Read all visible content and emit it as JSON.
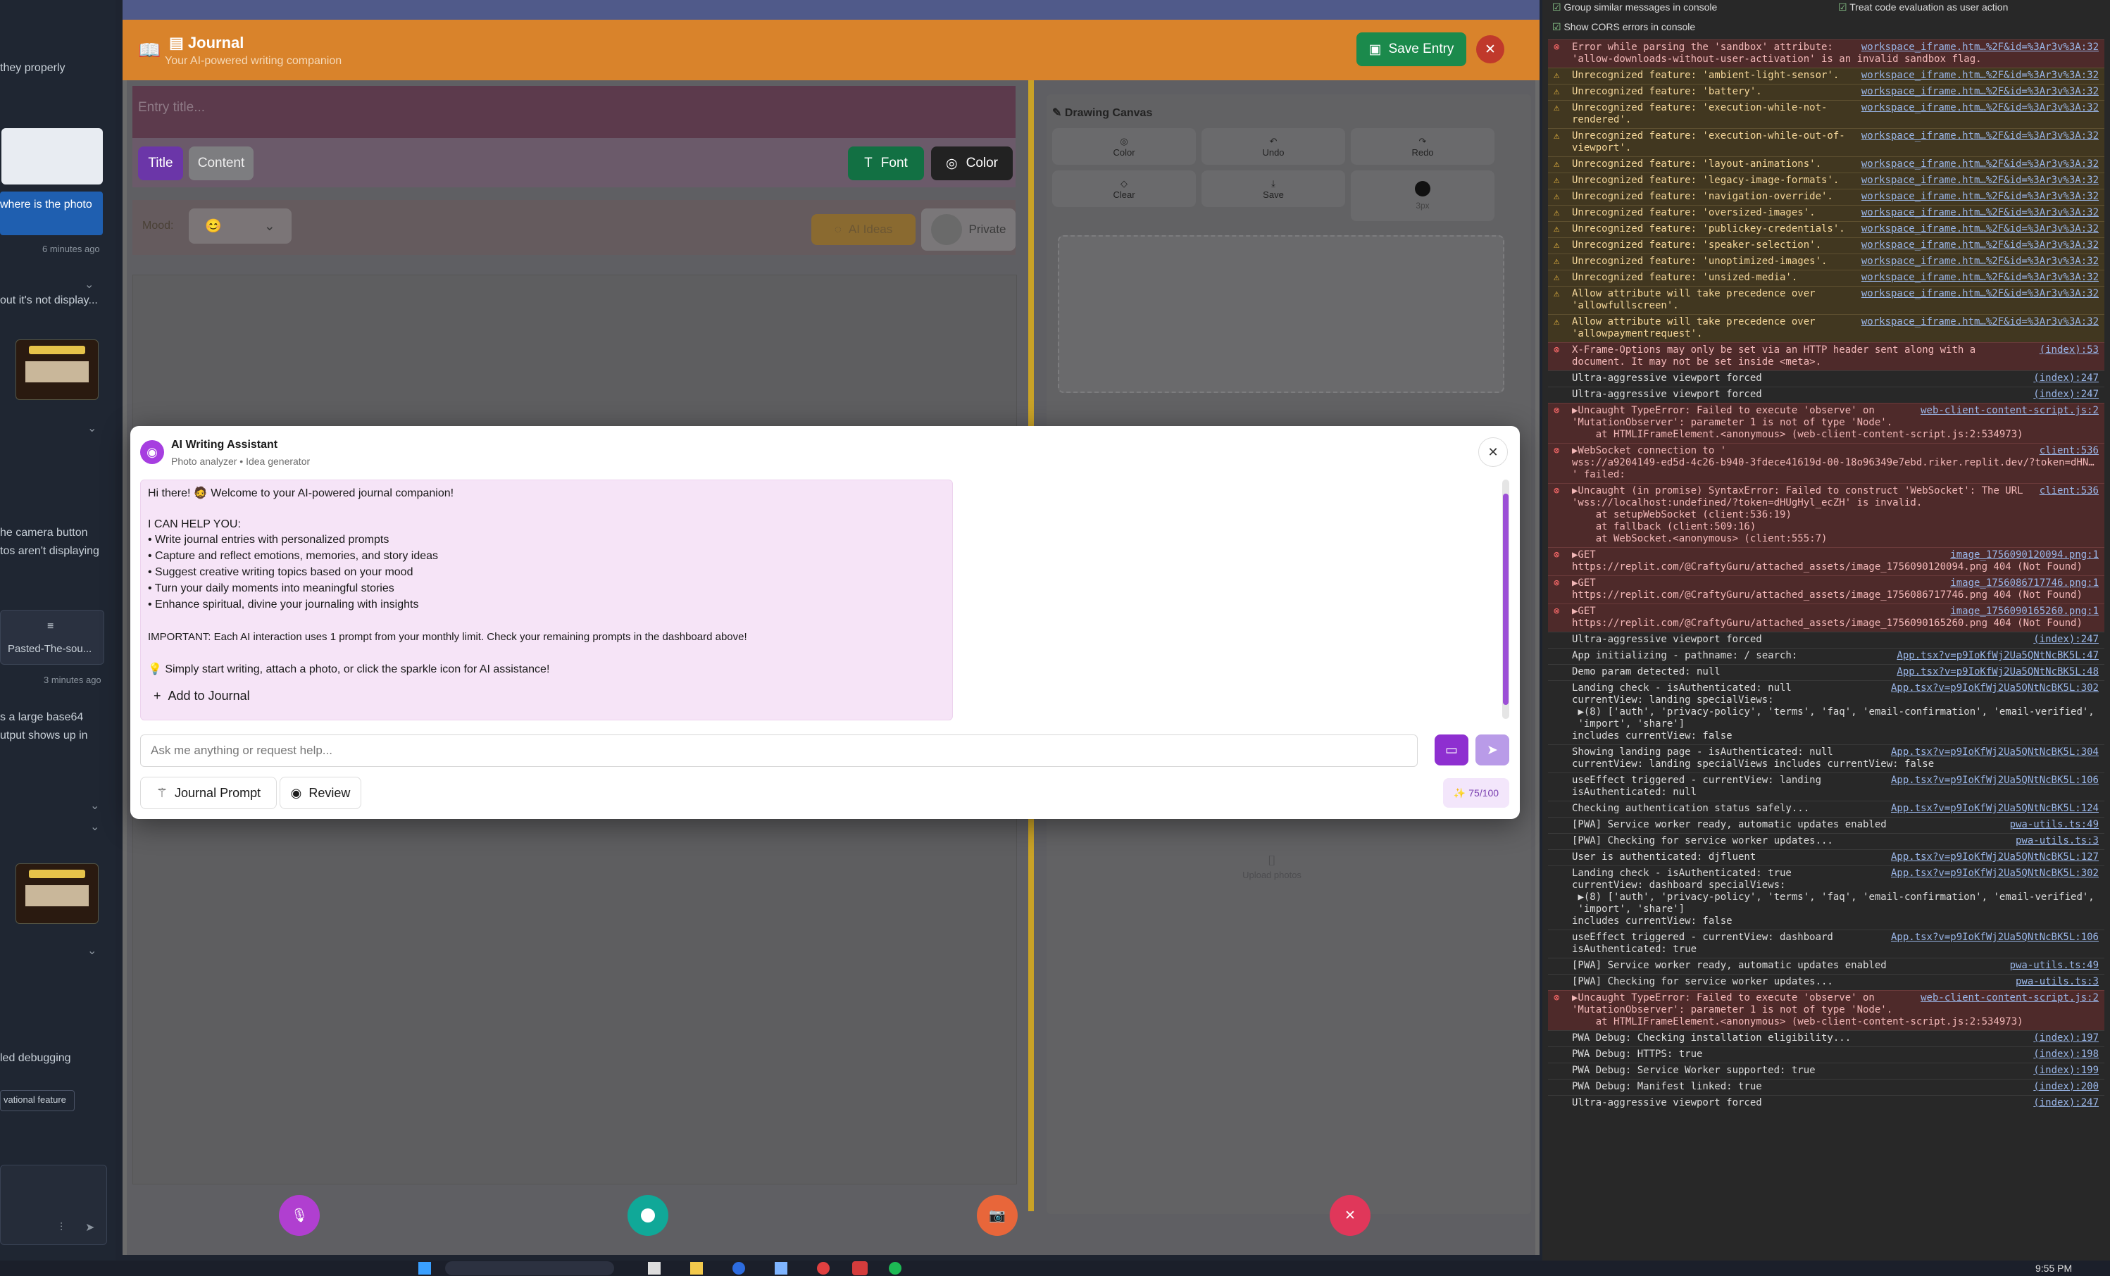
{
  "left_panel": {
    "snippets": [
      "they properly",
      "where is the photo",
      "6 minutes ago",
      "out it's not display...",
      "he camera button",
      "tos aren't displaying",
      "Pasted-The-sou...",
      "3 minutes ago",
      "s a large base64",
      "utput shows up in",
      "led debugging",
      "vational feature"
    ]
  },
  "journal": {
    "title": "Journal",
    "subtitle": "Your AI-powered writing companion",
    "save_label": "Save Entry",
    "title_placeholder": "Entry title...",
    "tab_title": "Title",
    "tab_content": "Content",
    "font_label": "Font",
    "color_label": "Color",
    "mood_label": "Mood:",
    "mood_value": "😊",
    "ai_ideas_label": "AI Ideas",
    "private_label": "Private",
    "upload_photos_label": "Upload photos"
  },
  "drawing": {
    "title": "Drawing Canvas",
    "tools": [
      "Color",
      "Undo",
      "Redo",
      "Clear",
      "Save",
      "3px"
    ]
  },
  "assistant": {
    "title": "AI Writing Assistant",
    "subtitle": "Photo analyzer • Idea generator",
    "greeting": "Hi there! 🧔 Welcome to your AI-powered journal companion!",
    "help_heading": "I CAN HELP YOU:",
    "help_items": [
      "• Write journal entries with personalized prompts",
      "• Capture and reflect emotions, memories, and story ideas",
      "• Suggest creative writing topics based on your mood",
      "• Turn your daily moments into meaningful stories",
      "• Enhance spiritual, divine your journaling with insights"
    ],
    "important": "IMPORTANT: Each AI interaction uses 1 prompt from your monthly limit. Check your remaining prompts in the dashboard above!",
    "tip": "💡 Simply start writing, attach a photo, or click the sparkle icon for AI assistance!",
    "add_label": "Add to Journal",
    "input_placeholder": "Ask me anything or request help...",
    "prompt_button": "Journal Prompt",
    "review_button": "Review",
    "quota": "✨ 75/100"
  },
  "console": {
    "options": [
      "Group similar messages in console",
      "Treat code evaluation as user action",
      "Show CORS errors in console"
    ],
    "messages": [
      {
        "level": "err",
        "text": "Error while parsing the 'sandbox' attribute:\n'allow-downloads-without-user-activation' is an invalid sandbox flag.",
        "src": "workspace_iframe.htm…%2F&id=%3Ar3v%3A:32"
      },
      {
        "level": "warn",
        "text": "Unrecognized feature: 'ambient-light-sensor'.",
        "src": "workspace_iframe.htm…%2F&id=%3Ar3v%3A:32"
      },
      {
        "level": "warn",
        "text": "Unrecognized feature: 'battery'.",
        "src": "workspace_iframe.htm…%2F&id=%3Ar3v%3A:32"
      },
      {
        "level": "warn",
        "text": "Unrecognized feature: 'execution-while-not-\nrendered'.",
        "src": "workspace_iframe.htm…%2F&id=%3Ar3v%3A:32"
      },
      {
        "level": "warn",
        "text": "Unrecognized feature: 'execution-while-out-of-\nviewport'.",
        "src": "workspace_iframe.htm…%2F&id=%3Ar3v%3A:32"
      },
      {
        "level": "warn",
        "text": "Unrecognized feature: 'layout-animations'.",
        "src": "workspace_iframe.htm…%2F&id=%3Ar3v%3A:32"
      },
      {
        "level": "warn",
        "text": "Unrecognized feature: 'legacy-image-formats'.",
        "src": "workspace_iframe.htm…%2F&id=%3Ar3v%3A:32"
      },
      {
        "level": "warn",
        "text": "Unrecognized feature: 'navigation-override'.",
        "src": "workspace_iframe.htm…%2F&id=%3Ar3v%3A:32"
      },
      {
        "level": "warn",
        "text": "Unrecognized feature: 'oversized-images'.",
        "src": "workspace_iframe.htm…%2F&id=%3Ar3v%3A:32"
      },
      {
        "level": "warn",
        "text": "Unrecognized feature: 'publickey-credentials'.",
        "src": "workspace_iframe.htm…%2F&id=%3Ar3v%3A:32"
      },
      {
        "level": "warn",
        "text": "Unrecognized feature: 'speaker-selection'.",
        "src": "workspace_iframe.htm…%2F&id=%3Ar3v%3A:32"
      },
      {
        "level": "warn",
        "text": "Unrecognized feature: 'unoptimized-images'.",
        "src": "workspace_iframe.htm…%2F&id=%3Ar3v%3A:32"
      },
      {
        "level": "warn",
        "text": "Unrecognized feature: 'unsized-media'.",
        "src": "workspace_iframe.htm…%2F&id=%3Ar3v%3A:32"
      },
      {
        "level": "warn",
        "text": "Allow attribute will take precedence over\n'allowfullscreen'.",
        "src": "workspace_iframe.htm…%2F&id=%3Ar3v%3A:32"
      },
      {
        "level": "warn",
        "text": "Allow attribute will take precedence over\n'allowpaymentrequest'.",
        "src": "workspace_iframe.htm…%2F&id=%3Ar3v%3A:32"
      },
      {
        "level": "err",
        "text": "X-Frame-Options may only be set via an HTTP header sent along with a\ndocument. It may not be set inside <meta>.",
        "src": "(index):53"
      },
      {
        "level": "info",
        "text": "Ultra-aggressive viewport forced",
        "src": "(index):247"
      },
      {
        "level": "info",
        "text": "Ultra-aggressive viewport forced",
        "src": "(index):247"
      },
      {
        "level": "err",
        "text": "▶Uncaught TypeError: Failed to execute 'observe' on\n'MutationObserver': parameter 1 is not of type 'Node'.\n    at HTMLIFrameElement.<anonymous> (web-client-content-script.js:2:534973)",
        "src": "web-client-content-script.js:2"
      },
      {
        "level": "err",
        "text": "▶WebSocket connection to '\nwss://a9204149-ed5d-4c26-b940-3fdece41619d-00-18o96349e7ebd.riker.replit.dev/?token=dHN…\n' failed:",
        "src": "client:536"
      },
      {
        "level": "err",
        "text": "▶Uncaught (in promise) SyntaxError: Failed to construct 'WebSocket': The URL\n'wss://localhost:undefined/?token=dHUgHyl_ecZH' is invalid.\n    at setupWebSocket (client:536:19)\n    at fallback (client:509:16)\n    at WebSocket.<anonymous> (client:555:7)",
        "src": "client:536"
      },
      {
        "level": "err",
        "text": "▶GET\nhttps://replit.com/@CraftyGuru/attached_assets/image_1756090120094.png 404 (Not Found)",
        "src": "image_1756090120094.png:1"
      },
      {
        "level": "err",
        "text": "▶GET\nhttps://replit.com/@CraftyGuru/attached_assets/image_1756086717746.png 404 (Not Found)",
        "src": "image_1756086717746.png:1"
      },
      {
        "level": "err",
        "text": "▶GET\nhttps://replit.com/@CraftyGuru/attached_assets/image_1756090165260.png 404 (Not Found)",
        "src": "image_1756090165260.png:1"
      },
      {
        "level": "info",
        "text": "Ultra-aggressive viewport forced",
        "src": "(index):247"
      },
      {
        "level": "info",
        "text": "App initializing - pathname: / search:",
        "src": "App.tsx?v=p9IoKfWj2Ua5QNtNcBK5L:47"
      },
      {
        "level": "info",
        "text": "Demo param detected: null",
        "src": "App.tsx?v=p9IoKfWj2Ua5QNtNcBK5L:48"
      },
      {
        "level": "info",
        "text": "Landing check - isAuthenticated: null\ncurrentView: landing specialViews:\n ▶(8) ['auth', 'privacy-policy', 'terms', 'faq', 'email-confirmation', 'email-verified',\n 'import', 'share']\nincludes currentView: false",
        "src": "App.tsx?v=p9IoKfWj2Ua5QNtNcBK5L:302"
      },
      {
        "level": "info",
        "text": "Showing landing page - isAuthenticated: null\ncurrentView: landing specialViews includes currentView: false",
        "src": "App.tsx?v=p9IoKfWj2Ua5QNtNcBK5L:304"
      },
      {
        "level": "info",
        "text": "useEffect triggered - currentView: landing\nisAuthenticated: null",
        "src": "App.tsx?v=p9IoKfWj2Ua5QNtNcBK5L:106"
      },
      {
        "level": "info",
        "text": "Checking authentication status safely...",
        "src": "App.tsx?v=p9IoKfWj2Ua5QNtNcBK5L:124"
      },
      {
        "level": "info",
        "text": "[PWA] Service worker ready, automatic updates enabled",
        "src": "pwa-utils.ts:49"
      },
      {
        "level": "info",
        "text": "[PWA] Checking for service worker updates...",
        "src": "pwa-utils.ts:3"
      },
      {
        "level": "info",
        "text": "User is authenticated: djfluent",
        "src": "App.tsx?v=p9IoKfWj2Ua5QNtNcBK5L:127"
      },
      {
        "level": "info",
        "text": "Landing check - isAuthenticated: true\ncurrentView: dashboard specialViews:\n ▶(8) ['auth', 'privacy-policy', 'terms', 'faq', 'email-confirmation', 'email-verified',\n 'import', 'share']\nincludes currentView: false",
        "src": "App.tsx?v=p9IoKfWj2Ua5QNtNcBK5L:302"
      },
      {
        "level": "info",
        "text": "useEffect triggered - currentView: dashboard\nisAuthenticated: true",
        "src": "App.tsx?v=p9IoKfWj2Ua5QNtNcBK5L:106"
      },
      {
        "level": "info",
        "text": "[PWA] Service worker ready, automatic updates enabled",
        "src": "pwa-utils.ts:49"
      },
      {
        "level": "info",
        "text": "[PWA] Checking for service worker updates...",
        "src": "pwa-utils.ts:3"
      },
      {
        "level": "err",
        "text": "▶Uncaught TypeError: Failed to execute 'observe' on\n'MutationObserver': parameter 1 is not of type 'Node'.\n    at HTMLIFrameElement.<anonymous> (web-client-content-script.js:2:534973)",
        "src": "web-client-content-script.js:2"
      },
      {
        "level": "info",
        "text": "PWA Debug: Checking installation eligibility...",
        "src": "(index):197"
      },
      {
        "level": "info",
        "text": "PWA Debug: HTTPS: true",
        "src": "(index):198"
      },
      {
        "level": "info",
        "text": "PWA Debug: Service Worker supported: true",
        "src": "(index):199"
      },
      {
        "level": "info",
        "text": "PWA Debug: Manifest linked: true",
        "src": "(index):200"
      },
      {
        "level": "info",
        "text": "Ultra-aggressive viewport forced",
        "src": "(index):247"
      }
    ]
  },
  "taskbar": {
    "clock": "9:55 PM"
  }
}
